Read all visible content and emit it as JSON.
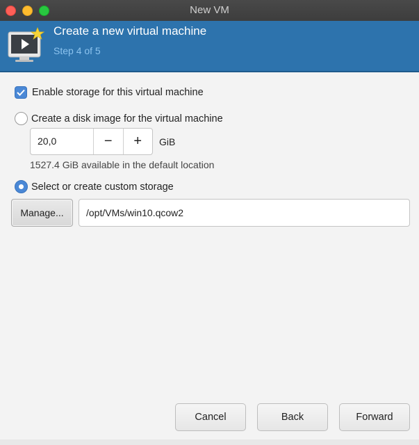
{
  "window": {
    "title": "New VM"
  },
  "banner": {
    "title": "Create a new virtual machine",
    "step": "Step 4 of 5",
    "icon": "vm-monitor-icon"
  },
  "storage": {
    "enable_label": "Enable storage for this virtual machine",
    "enable_checked": true,
    "disk_image_label": "Create a disk image for the virtual machine",
    "disk_image_selected": false,
    "size_value": "20,0",
    "decrement_label": "−",
    "increment_label": "+",
    "size_unit": "GiB",
    "available_text": "1527.4 GiB available in the default location",
    "custom_label": "Select or create custom storage",
    "custom_selected": true,
    "manage_label": "Manage...",
    "path_value": "/opt/VMs/win10.qcow2"
  },
  "buttons": {
    "cancel": "Cancel",
    "back": "Back",
    "forward": "Forward"
  },
  "colors": {
    "banner": "#2d73ad",
    "accent": "#4a88d6"
  }
}
